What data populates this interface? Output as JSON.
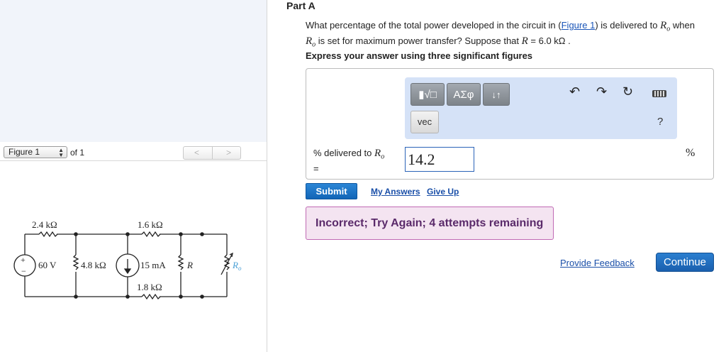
{
  "figure_nav": {
    "selected": "Figure 1",
    "of_label": "of 1",
    "prev_icon": "chevron-left-icon",
    "next_icon": "chevron-right-icon"
  },
  "circuit": {
    "r1": "2.4 kΩ",
    "r2": "1.6 kΩ",
    "r3": "1.8 kΩ",
    "r4": "4.8 kΩ",
    "vs": "60 V",
    "is": "15 mA",
    "r": "R",
    "ro": "R",
    "ro_sub": "o",
    "plus": "+",
    "minus": "−"
  },
  "part": {
    "title": "Part A"
  },
  "question": {
    "text_1": "What percentage of the total power developed in the circuit in (",
    "link": "Figure 1",
    "text_2": ") is delivered to ",
    "ro_var": "R",
    "ro_sub": "o",
    "text_3": " when",
    "text_4": " is set for maximum power transfer? Suppose that ",
    "r_var": "R",
    "text_5": " = 6.0  kΩ ."
  },
  "express": "Express your answer using three significant figures",
  "toolbar": {
    "sqrt_label": "▮√□",
    "greek_label": "ΑΣφ",
    "arrows_label": "↓↑",
    "vec_label": "vec",
    "help_label": "?",
    "icons": [
      "undo-icon",
      "redo-icon",
      "reset-icon",
      "keyboard-icon"
    ]
  },
  "answer": {
    "label": "% delivered to",
    "label_var": "R",
    "label_sub": "o",
    "eq": "=",
    "value": "14.2",
    "unit": "%"
  },
  "actions": {
    "submit": "Submit",
    "my_answers": "My Answers",
    "give_up": "Give Up"
  },
  "feedback": "Incorrect; Try Again; 4 attempts remaining",
  "footer": {
    "provide_feedback": "Provide Feedback",
    "continue": "Continue"
  },
  "colors": {
    "accent": "#1a5fae",
    "toolbar_bg": "#d5e2f7",
    "feedback_bg": "#f4e4f1",
    "feedback_border": "#c06ab4"
  }
}
